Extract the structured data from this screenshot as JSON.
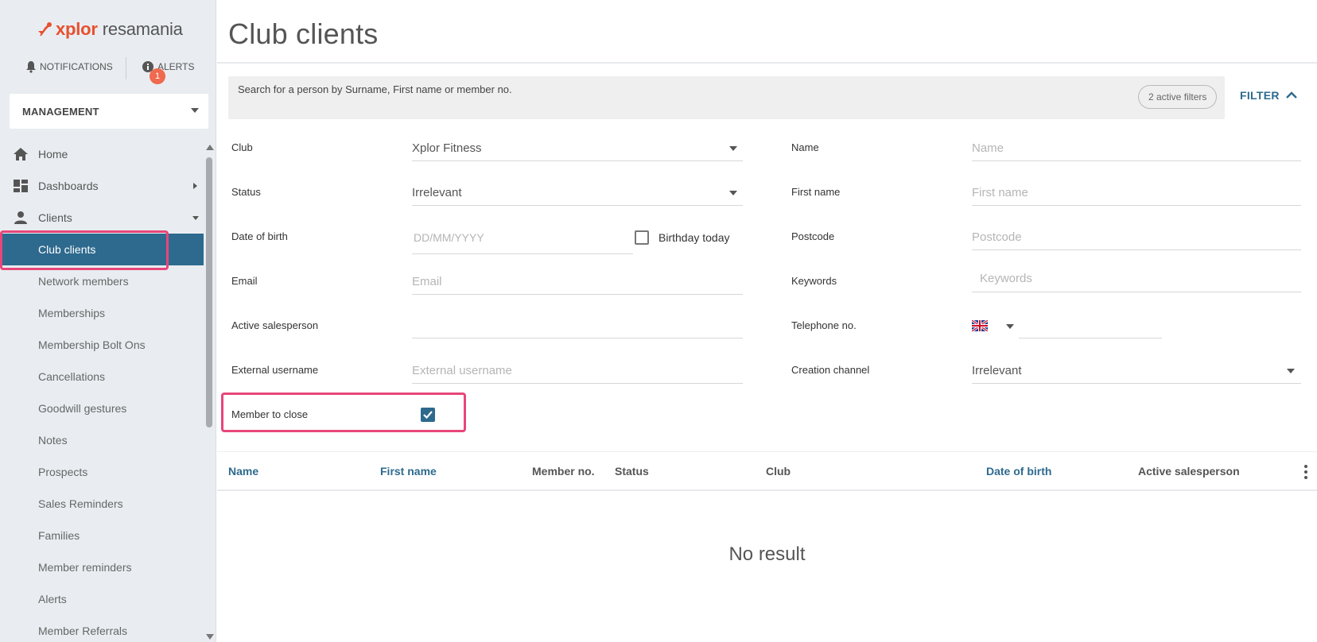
{
  "brand": {
    "name_a": "xplor",
    "name_b": "resamania"
  },
  "top": {
    "notifications": "NOTIFICATIONS",
    "alerts": "ALERTS",
    "alerts_badge": "1"
  },
  "menu_selector": {
    "label": "MANAGEMENT"
  },
  "sidebar": {
    "items": [
      {
        "label": "Home",
        "icon": "home-icon"
      },
      {
        "label": "Dashboards",
        "icon": "dashboard-icon"
      },
      {
        "label": "Clients",
        "icon": "person-icon"
      },
      {
        "label": "Club clients"
      },
      {
        "label": "Network members"
      },
      {
        "label": "Memberships"
      },
      {
        "label": "Membership Bolt Ons"
      },
      {
        "label": "Cancellations"
      },
      {
        "label": "Goodwill gestures"
      },
      {
        "label": "Notes"
      },
      {
        "label": "Prospects"
      },
      {
        "label": "Sales Reminders"
      },
      {
        "label": "Families"
      },
      {
        "label": "Member reminders"
      },
      {
        "label": "Alerts"
      },
      {
        "label": "Member Referrals"
      }
    ]
  },
  "page": {
    "title": "Club clients"
  },
  "search": {
    "placeholder": "Search for a person by Surname, First name or member no.",
    "active_filters": "2 active filters",
    "filter_button": "FILTER"
  },
  "filters": {
    "club": {
      "label": "Club",
      "value": "Xplor Fitness"
    },
    "status": {
      "label": "Status",
      "value": "Irrelevant"
    },
    "dob": {
      "label": "Date of birth",
      "placeholder": "DD/MM/YYYY",
      "birthday_today": "Birthday today"
    },
    "email": {
      "label": "Email",
      "placeholder": "Email"
    },
    "active_salesperson": {
      "label": "Active salesperson",
      "value": ""
    },
    "external_username": {
      "label": "External username",
      "placeholder": "External username"
    },
    "member_to_close": {
      "label": "Member to close",
      "checked": true
    },
    "name": {
      "label": "Name",
      "placeholder": "Name"
    },
    "first_name": {
      "label": "First name",
      "placeholder": "First name"
    },
    "postcode": {
      "label": "Postcode",
      "placeholder": "Postcode"
    },
    "keywords": {
      "label": "Keywords",
      "placeholder": "Keywords"
    },
    "telephone": {
      "label": "Telephone no.",
      "value": ""
    },
    "creation_channel": {
      "label": "Creation channel",
      "value": "Irrelevant"
    }
  },
  "table": {
    "columns": [
      "Name",
      "First name",
      "Member no.",
      "Status",
      "Club",
      "Date of birth",
      "Active salesperson"
    ],
    "empty": "No result"
  },
  "colors": {
    "accent": "#2e6a8e",
    "brand": "#e8502e",
    "highlight": "#e8467a"
  }
}
